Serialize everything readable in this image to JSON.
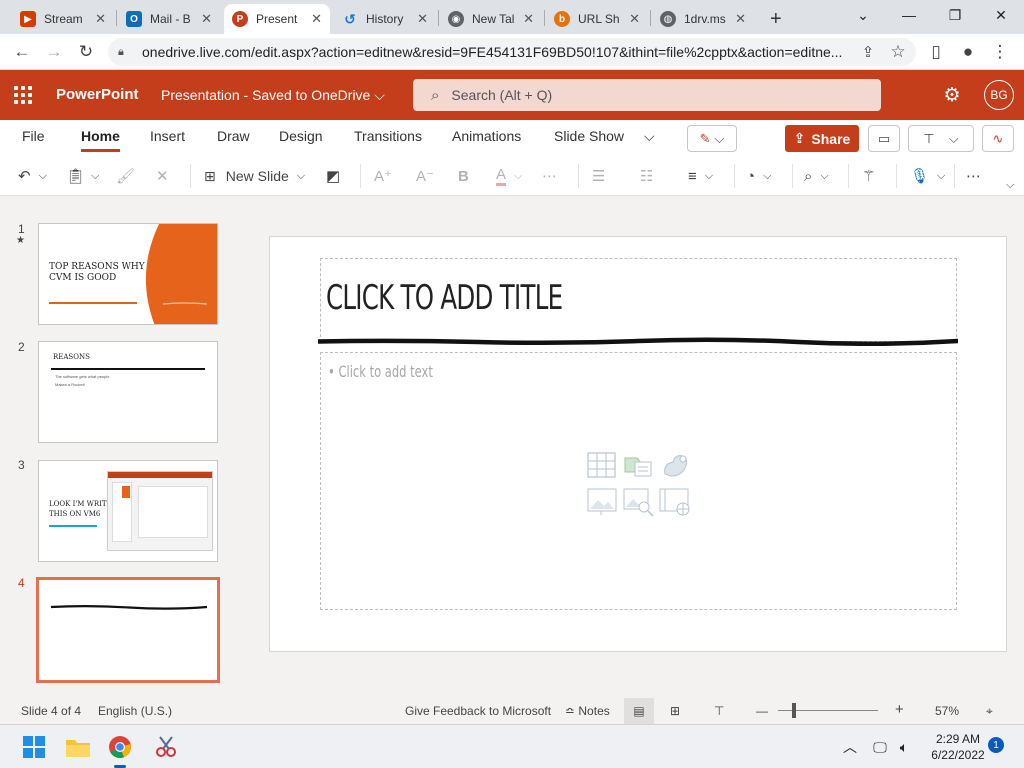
{
  "browser": {
    "tabs": [
      {
        "title": "Stream",
        "favicon": "stream-icon",
        "color": "#d83b01"
      },
      {
        "title": "Mail - B",
        "favicon": "outlook-icon",
        "color": "#0f6cbd"
      },
      {
        "title": "Present",
        "favicon": "powerpoint-icon",
        "color": "#c43e1c",
        "active": true
      },
      {
        "title": "History",
        "favicon": "history-icon",
        "color": "#1a73e8"
      },
      {
        "title": "New Tal",
        "favicon": "chrome-icon",
        "color": "#5f6368"
      },
      {
        "title": "URL Sh",
        "favicon": "url-shortener-icon",
        "color": "#e8710a"
      },
      {
        "title": "1drv.ms",
        "favicon": "globe-icon",
        "color": "#5f6368"
      }
    ],
    "url": "onedrive.live.com/edit.aspx?action=editnew&resid=9FE454131F69BD50!107&ithint=file%2cpptx&action=editne..."
  },
  "app": {
    "name": "PowerPoint",
    "doc_title": "Presentation",
    "doc_status": "Saved to OneDrive",
    "search_placeholder": "Search (Alt + Q)",
    "avatar_initials": "BG",
    "brand_color": "#c43e1c"
  },
  "ribbon": {
    "tabs": [
      "File",
      "Home",
      "Insert",
      "Draw",
      "Design",
      "Transitions",
      "Animations",
      "Slide Show"
    ],
    "active_tab": "Home",
    "share_label": "Share",
    "new_slide_label": "New Slide"
  },
  "thumbnails": [
    {
      "number": "1",
      "marker": "★",
      "title_line1": "TOP REASONS WHY",
      "title_line2": "CVM IS GOOD"
    },
    {
      "number": "2",
      "heading": "REASONS",
      "bullets": [
        "The software gets what people",
        "Makes a Rocket!"
      ]
    },
    {
      "number": "3",
      "title_line1": "LOOK I'M WRITING",
      "title_line2": "THIS ON VM6"
    },
    {
      "number": "4",
      "selected": true
    }
  ],
  "slide": {
    "title_placeholder": "CLICK TO ADD TITLE",
    "content_placeholder": "Click to add text"
  },
  "status": {
    "slide_info": "Slide 4 of 4",
    "language": "English (U.S.)",
    "feedback": "Give Feedback to Microsoft",
    "notes": "Notes",
    "zoom": "57%",
    "zoom_fraction": 0.18
  },
  "taskbar": {
    "time": "2:29 AM",
    "date": "6/22/2022",
    "notifications": "1"
  }
}
